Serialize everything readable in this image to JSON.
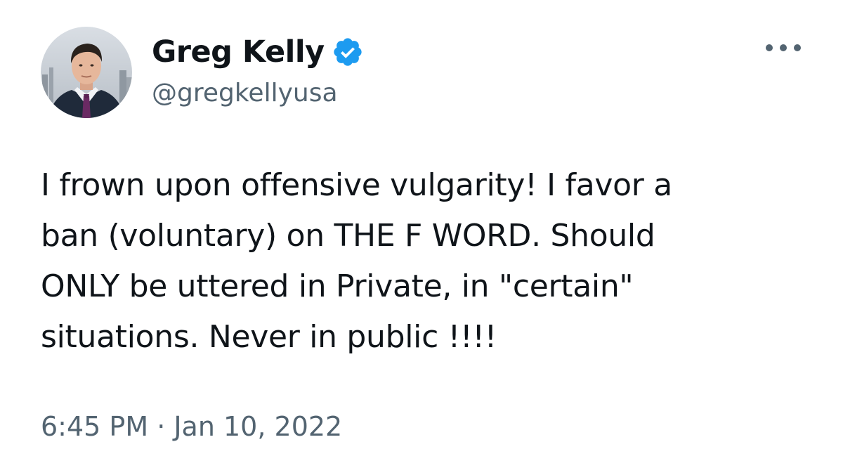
{
  "author": {
    "display_name": "Greg Kelly",
    "handle": "@gregkellyusa",
    "verified": true,
    "verified_color": "#1d9bf0",
    "avatar_icon": "profile-photo"
  },
  "menu": {
    "icon": "more-options-icon"
  },
  "tweet": {
    "text": "I frown upon offensive vulgarity!  I favor a\nban (voluntary) on THE F WORD. Should\nONLY be uttered in Private, in \"certain\"\nsituations. Never in public !!!!",
    "timestamp": "6:45 PM · Jan 10, 2022"
  },
  "colors": {
    "text_primary": "#0f1419",
    "text_secondary": "#536471",
    "background": "#ffffff"
  }
}
